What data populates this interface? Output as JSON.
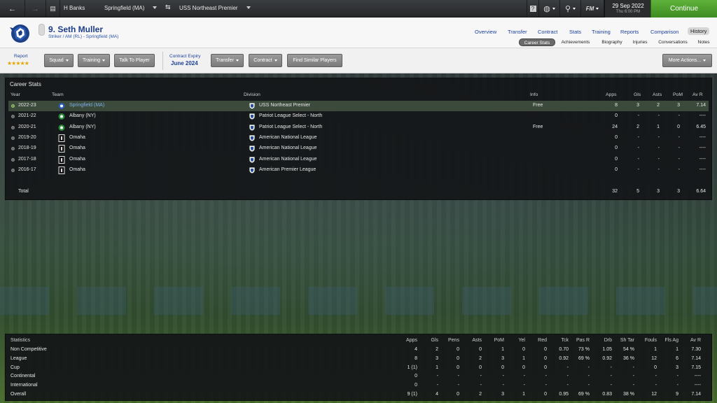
{
  "topbar": {
    "manager": "H Banks",
    "club": "Springfield (MA)",
    "competition": "USS Northeast Premier",
    "fm_label": "FM",
    "date": "29 Sep 2022",
    "day": "Thu 6:00 PM",
    "continue": "Continue"
  },
  "player": {
    "number_name": "9. Seth Muller",
    "subtitle": "Striker / AM (RL) - Springfield (MA)"
  },
  "nav": [
    "Overview",
    "Transfer",
    "Contract",
    "Stats",
    "Training",
    "Reports",
    "Comparison",
    "History"
  ],
  "subnav": [
    "Career Stats",
    "Achievements",
    "Biography",
    "Injuries",
    "Conversations",
    "Notes"
  ],
  "toolbar": {
    "report": "Report",
    "stars": "★★★★★",
    "squad": "Squad",
    "training": "Training",
    "talk": "Talk To Player",
    "contract_expiry_label": "Contract Expiry",
    "contract_expiry_value": "June 2024",
    "transfer": "Transfer",
    "contract": "Contract",
    "find_similar": "Find Similar Players",
    "more_actions": "More Actions..."
  },
  "career": {
    "title": "Career Stats",
    "headers": {
      "year": "Year",
      "team": "Team",
      "division": "Division",
      "info": "Info",
      "apps": "Apps",
      "gls": "Gls",
      "asts": "Asts",
      "pom": "PoM",
      "avr": "Av R"
    },
    "rows": [
      {
        "year": "2022-23",
        "team": "Springfield (MA)",
        "division": "USS Northeast Premier",
        "info": "Free",
        "apps": "8",
        "gls": "3",
        "asts": "2",
        "pom": "3",
        "avr": "7.14"
      },
      {
        "year": "2021-22",
        "team": "Albany (NY)",
        "division": "Patriot League Select - North",
        "info": "",
        "apps": "0",
        "gls": "-",
        "asts": "-",
        "pom": "-",
        "avr": "----"
      },
      {
        "year": "2020-21",
        "team": "Albany (NY)",
        "division": "Patriot League Select - North",
        "info": "Free",
        "apps": "24",
        "gls": "2",
        "asts": "1",
        "pom": "0",
        "avr": "6.45"
      },
      {
        "year": "2019-20",
        "team": "Omaha",
        "division": "American National League",
        "info": "",
        "apps": "0",
        "gls": "-",
        "asts": "-",
        "pom": "-",
        "avr": "----"
      },
      {
        "year": "2018-19",
        "team": "Omaha",
        "division": "American National League",
        "info": "",
        "apps": "0",
        "gls": "-",
        "asts": "-",
        "pom": "-",
        "avr": "----"
      },
      {
        "year": "2017-18",
        "team": "Omaha",
        "division": "American National League",
        "info": "",
        "apps": "0",
        "gls": "-",
        "asts": "-",
        "pom": "-",
        "avr": "----"
      },
      {
        "year": "2016-17",
        "team": "Omaha",
        "division": "American Premier League",
        "info": "",
        "apps": "0",
        "gls": "-",
        "asts": "-",
        "pom": "-",
        "avr": "----"
      }
    ],
    "total": {
      "label": "Total",
      "apps": "32",
      "gls": "5",
      "asts": "3",
      "pom": "3",
      "avr": "6.64"
    }
  },
  "statistics": {
    "headers": [
      "Statistics",
      "Apps",
      "Gls",
      "Pens",
      "Asts",
      "PoM",
      "Yel",
      "Red",
      "Tck",
      "Pas R",
      "Drb",
      "Sh Tar",
      "Fouls",
      "Fls Ag",
      "Av R"
    ],
    "rows": [
      [
        "Non Competitive",
        "4",
        "2",
        "0",
        "0",
        "1",
        "0",
        "0",
        "0.70",
        "73 %",
        "1.05",
        "54 %",
        "1",
        "1",
        "7.30"
      ],
      [
        "League",
        "8",
        "3",
        "0",
        "2",
        "3",
        "1",
        "0",
        "0.92",
        "69 %",
        "0.92",
        "36 %",
        "12",
        "6",
        "7.14"
      ],
      [
        "Cup",
        "1 (1)",
        "1",
        "0",
        "0",
        "0",
        "0",
        "0",
        "-",
        "-",
        "-",
        "-",
        "0",
        "3",
        "7.15"
      ],
      [
        "Continental",
        "0",
        "-",
        "-",
        "-",
        "-",
        "-",
        "-",
        "-",
        "-",
        "-",
        "-",
        "-",
        "-",
        "----"
      ],
      [
        "International",
        "0",
        "-",
        "-",
        "-",
        "-",
        "-",
        "-",
        "-",
        "-",
        "-",
        "-",
        "-",
        "-",
        "----"
      ],
      [
        "Overall",
        "9 (1)",
        "4",
        "0",
        "2",
        "3",
        "1",
        "0",
        "0.95",
        "69 %",
        "0.83",
        "38 %",
        "12",
        "9",
        "7.14"
      ]
    ]
  }
}
